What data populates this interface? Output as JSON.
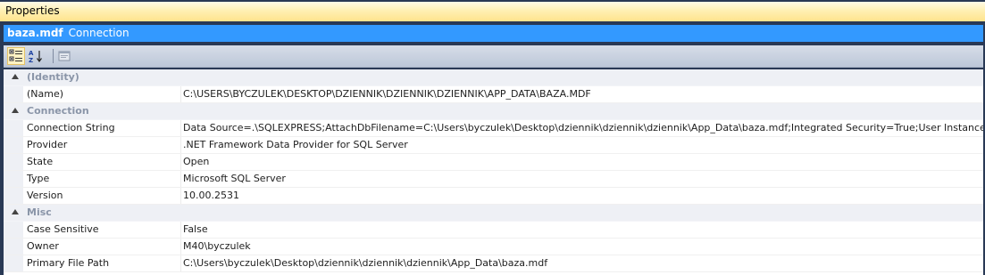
{
  "window": {
    "title": "Properties"
  },
  "object_selector": {
    "name": "baza.mdf",
    "type": "Connection"
  },
  "toolbar": {
    "buttons": [
      {
        "icon": "categorized-icon",
        "active": true
      },
      {
        "icon": "alphabetical-sort-icon",
        "active": false
      },
      {
        "icon": "property-pages-icon",
        "active": false
      }
    ]
  },
  "categories": [
    {
      "label": "(Identity)",
      "properties": [
        {
          "name": "(Name)",
          "value": "C:\\USERS\\BYCZULEK\\DESKTOP\\DZIENNIK\\DZIENNIK\\DZIENNIK\\APP_DATA\\BAZA.MDF"
        }
      ]
    },
    {
      "label": "Connection",
      "properties": [
        {
          "name": "Connection String",
          "value": "Data Source=.\\SQLEXPRESS;AttachDbFilename=C:\\Users\\byczulek\\Desktop\\dziennik\\dziennik\\dziennik\\App_Data\\baza.mdf;Integrated Security=True;User Instance=True"
        },
        {
          "name": "Provider",
          "value": ".NET Framework Data Provider for SQL Server"
        },
        {
          "name": "State",
          "value": "Open"
        },
        {
          "name": "Type",
          "value": "Microsoft SQL Server"
        },
        {
          "name": "Version",
          "value": "10.00.2531"
        }
      ]
    },
    {
      "label": "Misc",
      "properties": [
        {
          "name": "Case Sensitive",
          "value": "False"
        },
        {
          "name": "Owner",
          "value": "M40\\byczulek"
        },
        {
          "name": "Primary File Path",
          "value": "C:\\Users\\byczulek\\Desktop\\dziennik\\dziennik\\dziennik\\App_Data\\baza.mdf"
        }
      ]
    }
  ]
}
